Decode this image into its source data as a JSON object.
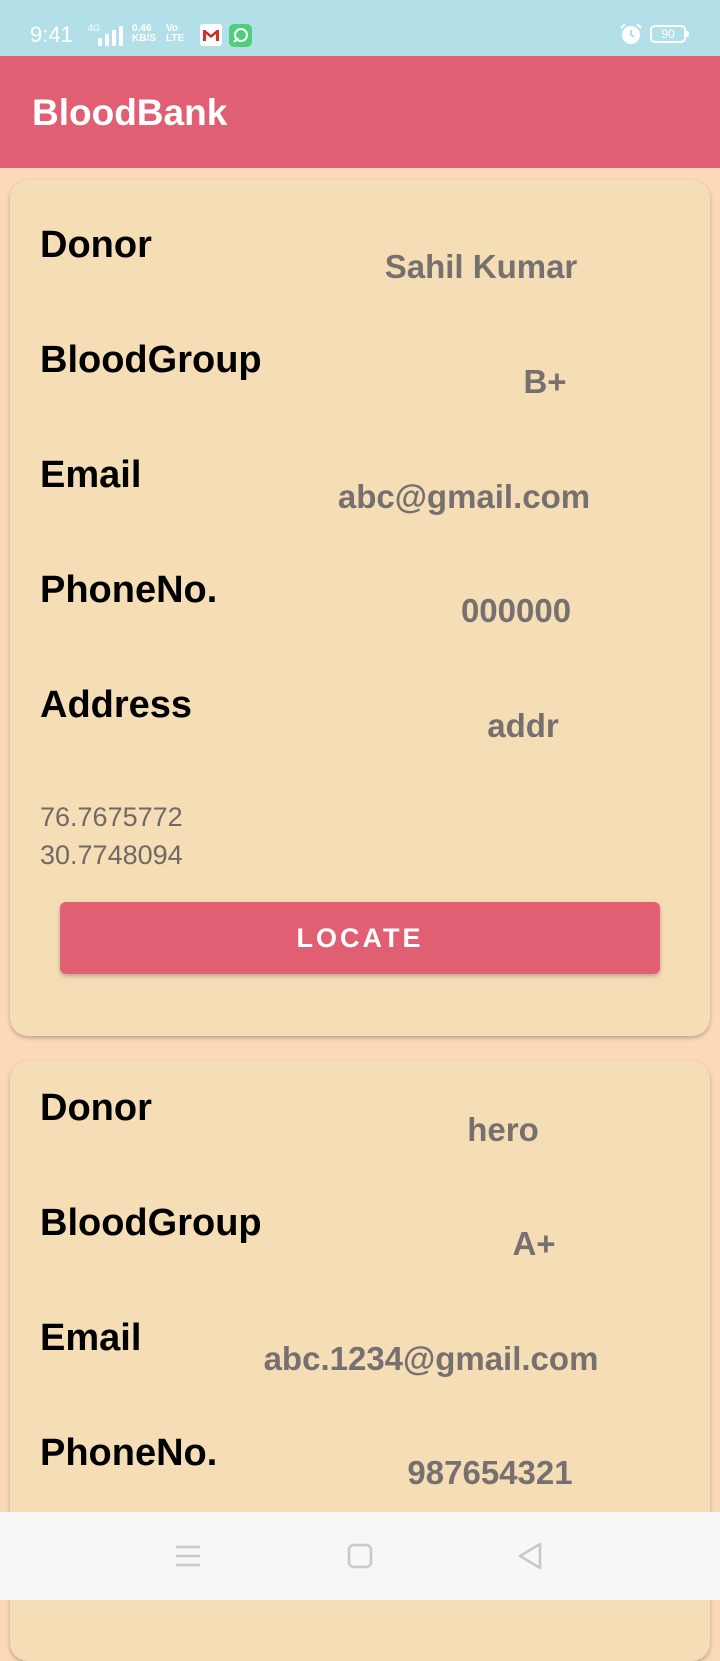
{
  "status_bar": {
    "time": "9:41",
    "network_type": "4G",
    "speed_value": "0.46",
    "speed_unit": "KB/S",
    "volte_top": "Vo",
    "volte_bottom": "LTE",
    "battery": "90",
    "icons": [
      "signal-icon",
      "gmail-icon",
      "app-notification-icon",
      "alarm-icon",
      "battery-icon"
    ]
  },
  "app_bar": {
    "title": "BloodBank"
  },
  "labels": {
    "donor": "Donor",
    "blood_group": "BloodGroup",
    "email": "Email",
    "phone": "PhoneNo.",
    "address": "Address"
  },
  "donors": [
    {
      "name": "Sahil Kumar",
      "blood_group": "B+",
      "email": "abc@gmail.com",
      "phone": "000000",
      "address": "addr",
      "longitude": "76.7675772",
      "latitude": "30.7748094",
      "locate_label": "LOCATE"
    },
    {
      "name": "hero",
      "blood_group": "A+",
      "email": "abc.1234@gmail.com",
      "phone": "987654321"
    }
  ],
  "nav_bar": {
    "icons": [
      "menu-icon",
      "home-icon",
      "back-icon"
    ]
  },
  "colors": {
    "status_bar": "#b3e0e8",
    "accent": "#e15f73",
    "background": "#fcd9b8",
    "card": "#f5ddb5",
    "value_text": "#777070"
  }
}
